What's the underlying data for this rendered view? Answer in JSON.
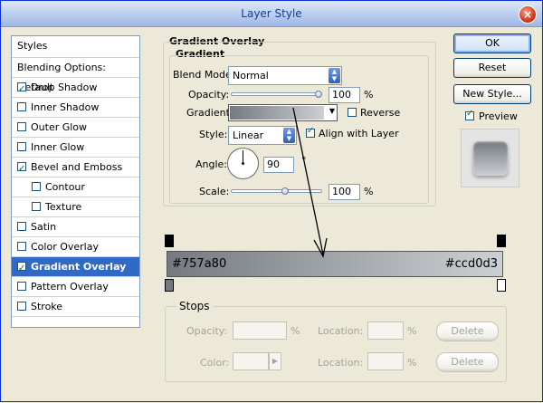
{
  "window": {
    "title": "Layer Style",
    "close_glyph": "×"
  },
  "styles_panel": {
    "header": "Styles",
    "items": [
      {
        "label": "Blending Options: Default",
        "checkbox": false,
        "checked": false,
        "indent": false,
        "selected": false
      },
      {
        "label": "Drop Shadow",
        "checkbox": true,
        "checked": true,
        "indent": false,
        "selected": false
      },
      {
        "label": "Inner Shadow",
        "checkbox": true,
        "checked": false,
        "indent": false,
        "selected": false
      },
      {
        "label": "Outer Glow",
        "checkbox": true,
        "checked": false,
        "indent": false,
        "selected": false
      },
      {
        "label": "Inner Glow",
        "checkbox": true,
        "checked": false,
        "indent": false,
        "selected": false
      },
      {
        "label": "Bevel and Emboss",
        "checkbox": true,
        "checked": true,
        "indent": false,
        "selected": false
      },
      {
        "label": "Contour",
        "checkbox": true,
        "checked": false,
        "indent": true,
        "selected": false
      },
      {
        "label": "Texture",
        "checkbox": true,
        "checked": false,
        "indent": true,
        "selected": false
      },
      {
        "label": "Satin",
        "checkbox": true,
        "checked": false,
        "indent": false,
        "selected": false
      },
      {
        "label": "Color Overlay",
        "checkbox": true,
        "checked": false,
        "indent": false,
        "selected": false
      },
      {
        "label": "Gradient Overlay",
        "checkbox": true,
        "checked": true,
        "indent": false,
        "selected": true
      },
      {
        "label": "Pattern Overlay",
        "checkbox": true,
        "checked": false,
        "indent": false,
        "selected": false
      },
      {
        "label": "Stroke",
        "checkbox": true,
        "checked": false,
        "indent": false,
        "selected": false
      }
    ]
  },
  "gradient_overlay": {
    "section_title": "Gradient Overlay",
    "group_title": "Gradient",
    "blend_mode_label": "Blend Mode:",
    "blend_mode_value": "Normal",
    "opacity_label": "Opacity:",
    "opacity_value": "100",
    "opacity_fraction": 1.0,
    "percent": "%",
    "gradient_label": "Gradient:",
    "reverse_label": "Reverse",
    "reverse_checked": false,
    "style_label": "Style:",
    "style_value": "Linear",
    "align_label": "Align with Layer",
    "align_checked": true,
    "angle_label": "Angle:",
    "angle_value": "90",
    "degree": "°",
    "scale_label": "Scale:",
    "scale_value": "100",
    "scale_fraction": 0.6
  },
  "gradient_editor": {
    "left_color_text": "#757a80",
    "right_color_text": "#ccd0d3",
    "left_color": "#757a80",
    "right_color": "#ccd0d3"
  },
  "stops": {
    "title": "Stops",
    "opacity_label": "Opacity:",
    "color_label": "Color:",
    "location_label": "Location:",
    "percent": "%",
    "delete_label": "Delete"
  },
  "buttons": {
    "ok": "OK",
    "reset": "Reset",
    "new_style": "New Style...",
    "preview": "Preview",
    "preview_checked": true
  }
}
